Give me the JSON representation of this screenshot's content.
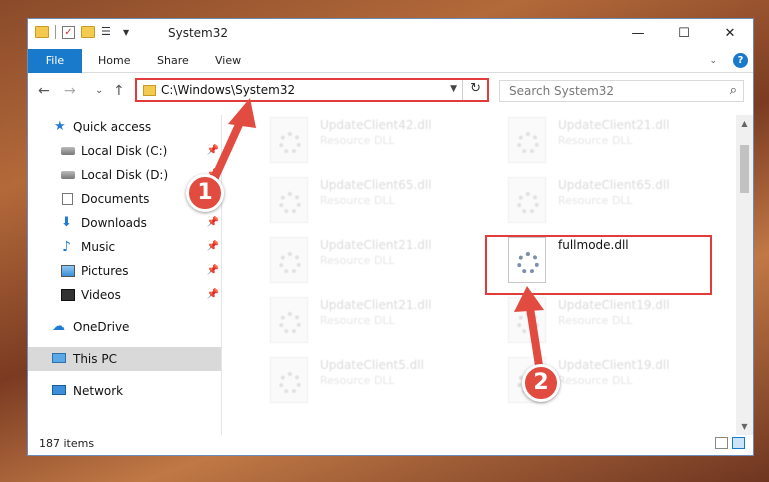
{
  "window": {
    "title": "System32"
  },
  "window_controls": {
    "minimize": "—",
    "maximize": "☐",
    "close": "✕"
  },
  "ribbon": {
    "file_tab": "File",
    "tabs": [
      "Home",
      "Share",
      "View"
    ],
    "expand_glyph": "⌄",
    "help_glyph": "?"
  },
  "nav": {
    "back": "←",
    "forward": "→",
    "recent": "⌄",
    "up": "↑",
    "address_path": "C:\\Windows\\System32",
    "search_placeholder": "Search System32"
  },
  "sidebar": {
    "items": [
      {
        "label": "Quick access",
        "icon": "star-icon",
        "pinned": false
      },
      {
        "label": "Local Disk (C:)",
        "icon": "disk-icon",
        "pinned": true
      },
      {
        "label": "Local Disk (D:)",
        "icon": "disk-icon",
        "pinned": true
      },
      {
        "label": "Documents",
        "icon": "document-icon",
        "pinned": true
      },
      {
        "label": "Downloads",
        "icon": "download-icon",
        "pinned": true
      },
      {
        "label": "Music",
        "icon": "music-icon",
        "pinned": true
      },
      {
        "label": "Pictures",
        "icon": "pictures-icon",
        "pinned": true
      },
      {
        "label": "Videos",
        "icon": "videos-icon",
        "pinned": true
      },
      {
        "label": "OneDrive",
        "icon": "cloud-icon",
        "pinned": false
      },
      {
        "label": "This PC",
        "icon": "computer-icon",
        "pinned": false,
        "selected": true
      },
      {
        "label": "Network",
        "icon": "network-icon",
        "pinned": false
      }
    ],
    "pin_glyph": "📌"
  },
  "files": [
    {
      "name": "UpdateClient42.dll",
      "desc": "Resource DLL"
    },
    {
      "name": "UpdateClient21.dll",
      "desc": "Resource DLL"
    },
    {
      "name": "UpdateClient65.dll",
      "desc": "Resource DLL"
    },
    {
      "name": "UpdateClient65.dll",
      "desc": "Resource DLL"
    },
    {
      "name": "UpdateClient21.dll",
      "desc": "Resource DLL"
    },
    {
      "name": "fullmode.dll",
      "desc": ""
    },
    {
      "name": "UpdateClient21.dll",
      "desc": "Resource DLL"
    },
    {
      "name": "UpdateClient19.dll",
      "desc": "Resource DLL"
    },
    {
      "name": "UpdateClient5.dll",
      "desc": "Resource DLL"
    },
    {
      "name": "UpdateClient19.dll",
      "desc": "Resource DLL"
    }
  ],
  "status": {
    "item_count": "187 items"
  },
  "annotations": {
    "step1": "1",
    "step2": "2",
    "color": "#e24b3f"
  }
}
